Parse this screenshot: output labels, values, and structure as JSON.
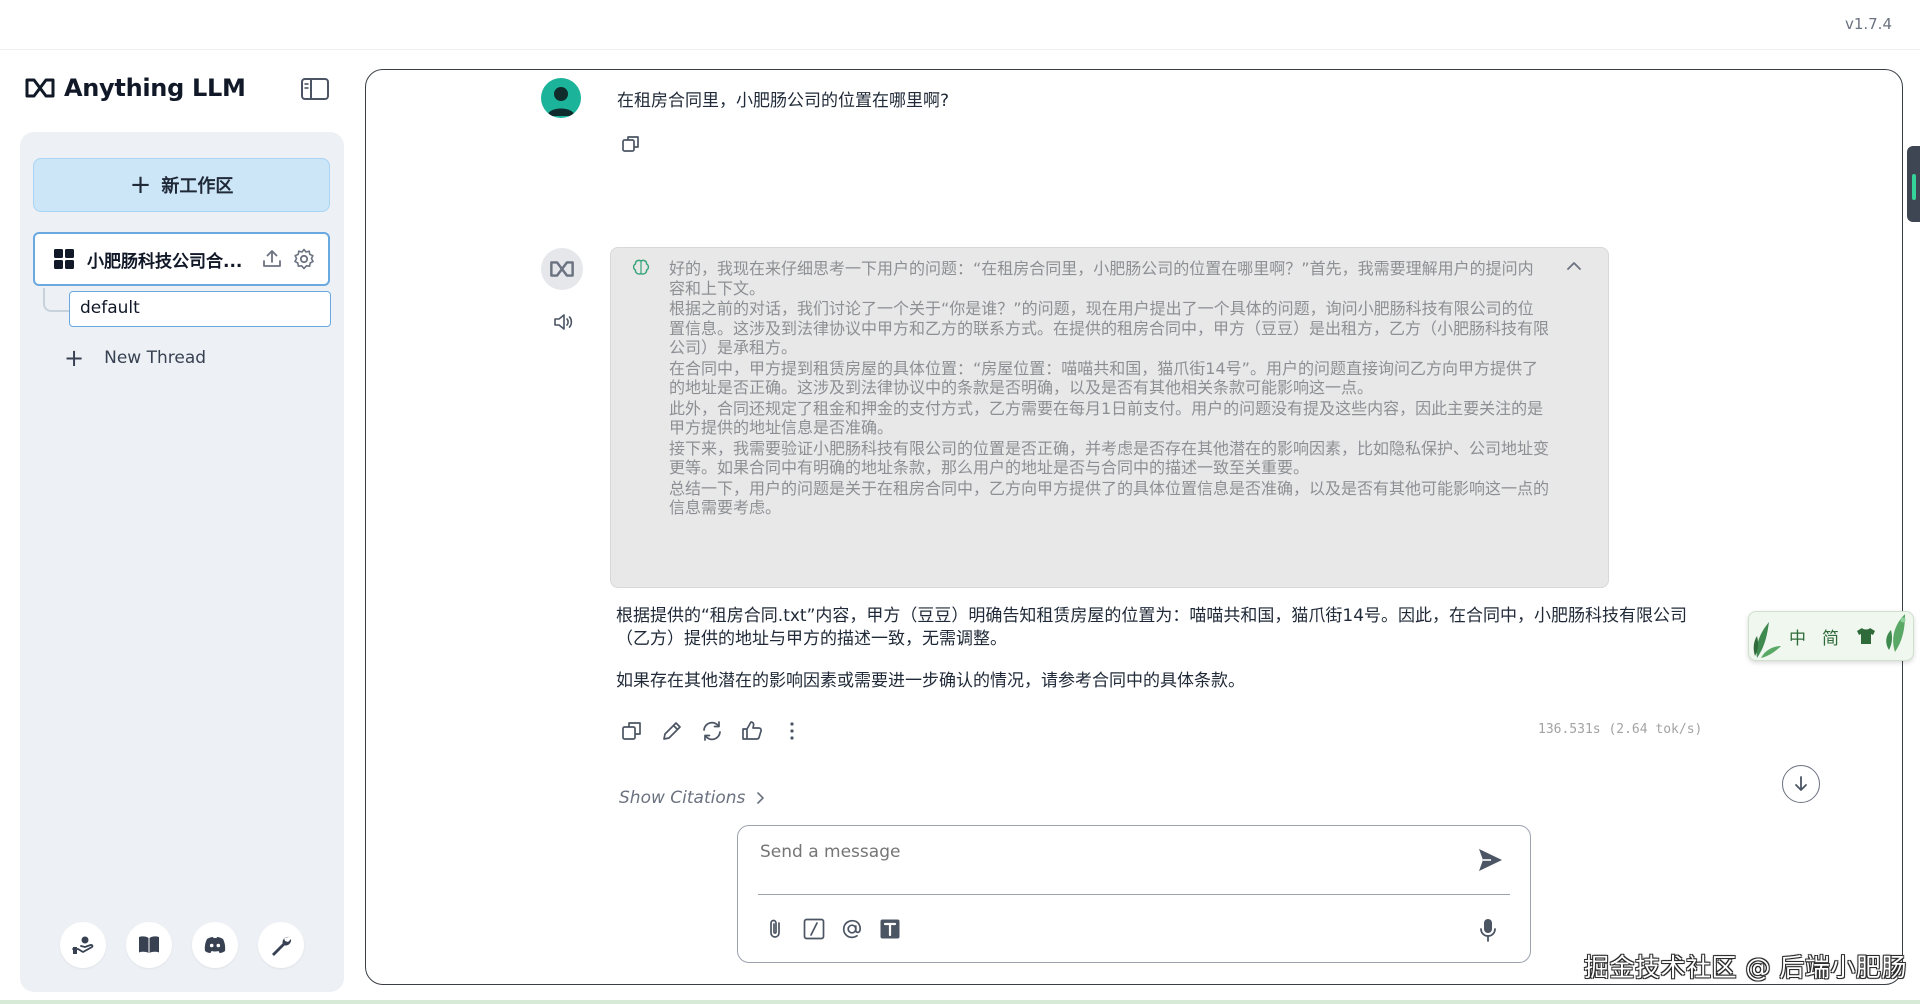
{
  "app": {
    "version": "v1.7.4",
    "name": "Anything LLM"
  },
  "sidebar": {
    "new_workspace_label": "新工作区",
    "workspace": {
      "name": "小肥肠科技公司合..."
    },
    "threads": [
      {
        "label": "default"
      }
    ],
    "new_thread_label": "New Thread",
    "footer_icons": [
      "community-hub-icon",
      "docs-book-icon",
      "discord-icon",
      "settings-wrench-icon"
    ]
  },
  "chat": {
    "user_message": "在租房合同里，小肥肠公司的位置在哪里啊?",
    "thought_paragraphs": [
      "好的，我现在来仔细思考一下用户的问题：“在租房合同里，小肥肠公司的位置在哪里啊？”首先，我需要理解用户的提问内容和上下文。",
      "根据之前的对话，我们讨论了一个关于“你是谁？”的问题，现在用户提出了一个具体的问题，询问小肥肠科技有限公司的位置信息。这涉及到法律协议中甲方和乙方的联系方式。在提供的租房合同中，甲方（豆豆）是出租方，乙方（小肥肠科技有限公司）是承租方。",
      "在合同中，甲方提到租赁房屋的具体位置：“房屋位置：喵喵共和国，猫爪街14号”。用户的问题直接询问乙方向甲方提供了的地址是否正确。这涉及到法律协议中的条款是否明确，以及是否有其他相关条款可能影响这一点。",
      "此外，合同还规定了租金和押金的支付方式，乙方需要在每月1日前支付。用户的问题没有提及这些内容，因此主要关注的是甲方提供的地址信息是否准确。",
      "接下来，我需要验证小肥肠科技有限公司的位置是否正确，并考虑是否存在其他潜在的影响因素，比如隐私保护、公司地址变更等。如果合同中有明确的地址条款，那么用户的地址是否与合同中的描述一致至关重要。",
      "总结一下，用户的问题是关于在租房合同中，乙方向甲方提供了的具体位置信息是否准确，以及是否有其他可能影响这一点的信息需要考虑。"
    ],
    "answer_paragraphs": [
      "根据提供的“租房合同.txt”内容，甲方（豆豆）明确告知租赁房屋的位置为：喵喵共和国，猫爪街14号。因此，在合同中，小肥肠科技有限公司（乙方）提供的地址与甲方的描述一致，无需调整。",
      "如果存在其他潜在的影响因素或需要进一步确认的情况，请参考合同中的具体条款。"
    ],
    "timing": "136.531s (2.64 tok/s)",
    "show_citations_label": "Show Citations"
  },
  "input": {
    "placeholder": "Send a message"
  },
  "overlay": {
    "ime_chars": [
      "中",
      "简"
    ],
    "watermark": "掘金技术社区 @ 后端小肥肠"
  },
  "colors": {
    "accent_button": "#cce6f8",
    "selected_border": "#6aa8e0",
    "user_avatar": "#1cb39b",
    "thought_bg": "#e8e8e8"
  }
}
